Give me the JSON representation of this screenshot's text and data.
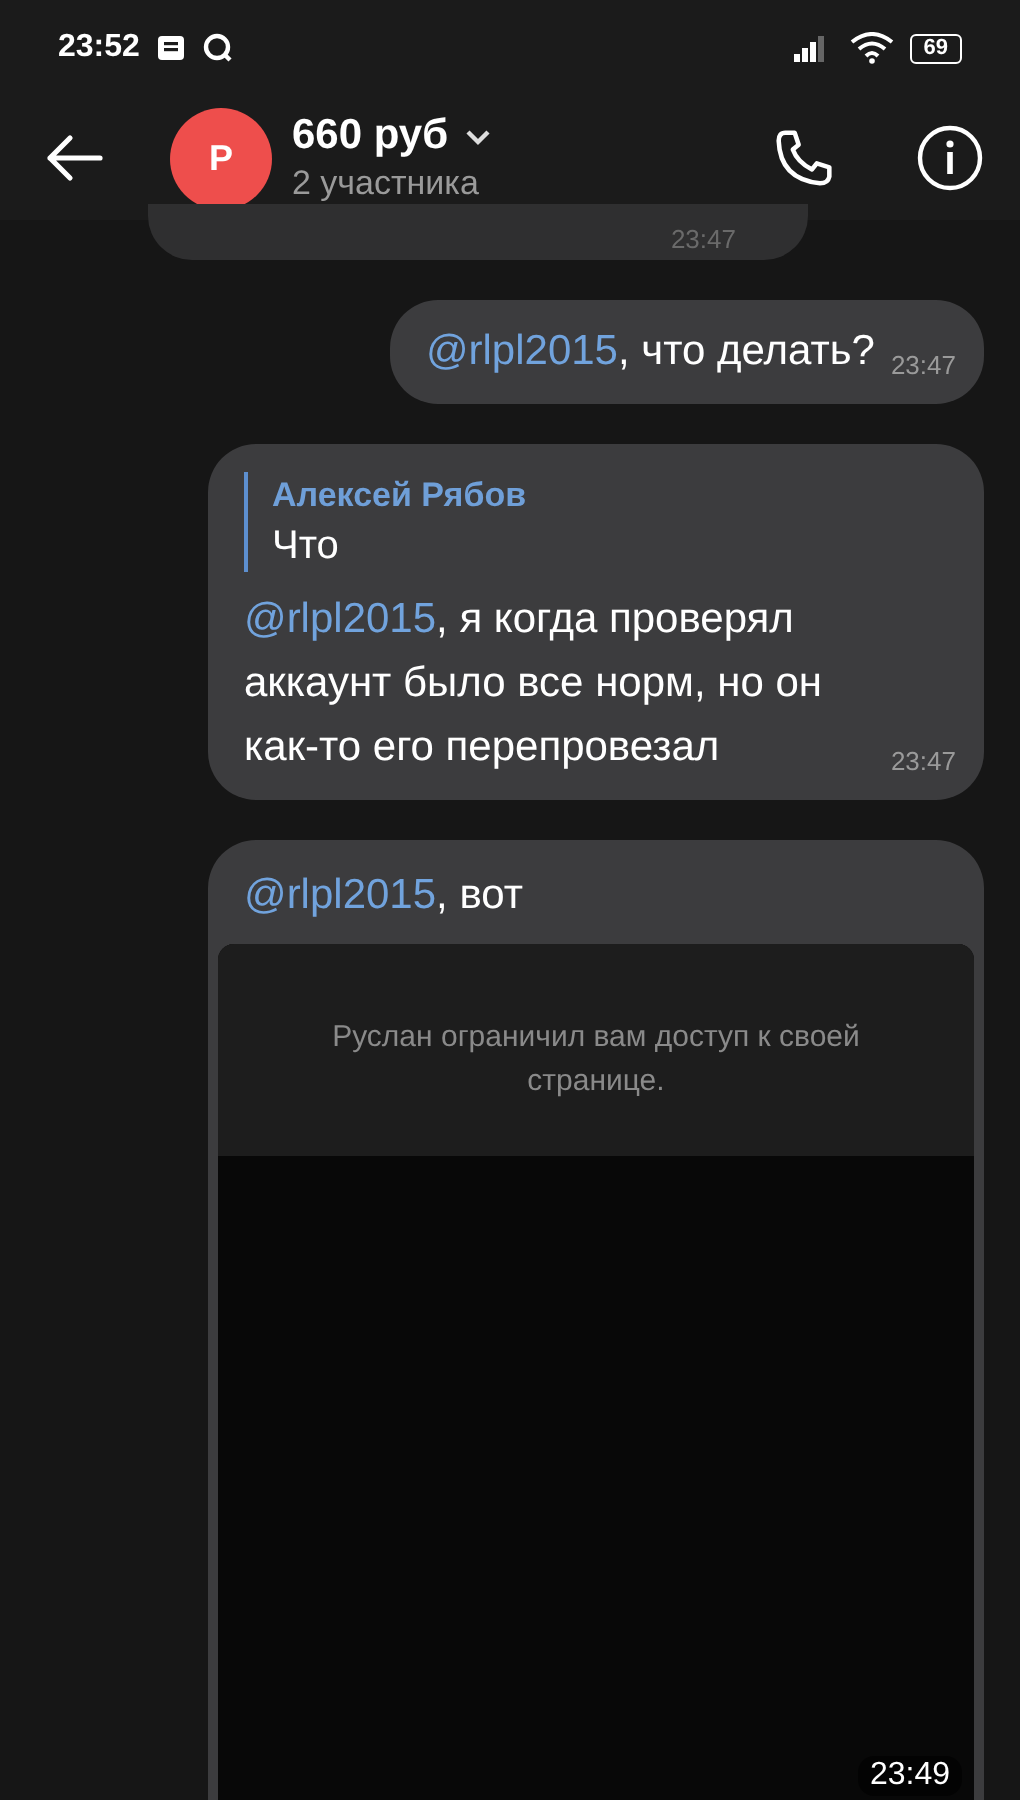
{
  "status_bar": {
    "time": "23:52",
    "battery": "69"
  },
  "header": {
    "avatar_letter": "Р",
    "title": "660 руб",
    "subtitle": "2 участника"
  },
  "messages": [
    {
      "kind": "partial",
      "time": "23:47"
    },
    {
      "kind": "text",
      "outgoing": true,
      "mention": "@rlpl2015",
      "text": ",  что делать?",
      "time": "23:47"
    },
    {
      "kind": "reply",
      "outgoing": true,
      "reply_author": "Алексей Рябов",
      "reply_text": "Что",
      "mention": "@rlpl2015",
      "text": ",  я когда проверял аккаунт было все норм, но он как-то его перепровезал",
      "time": "23:47"
    },
    {
      "kind": "image",
      "outgoing": true,
      "mention": "@rlpl2015",
      "text": ", вот",
      "image_text": "Руслан ограничил вам доступ к своей странице.",
      "time": "23:49"
    }
  ]
}
